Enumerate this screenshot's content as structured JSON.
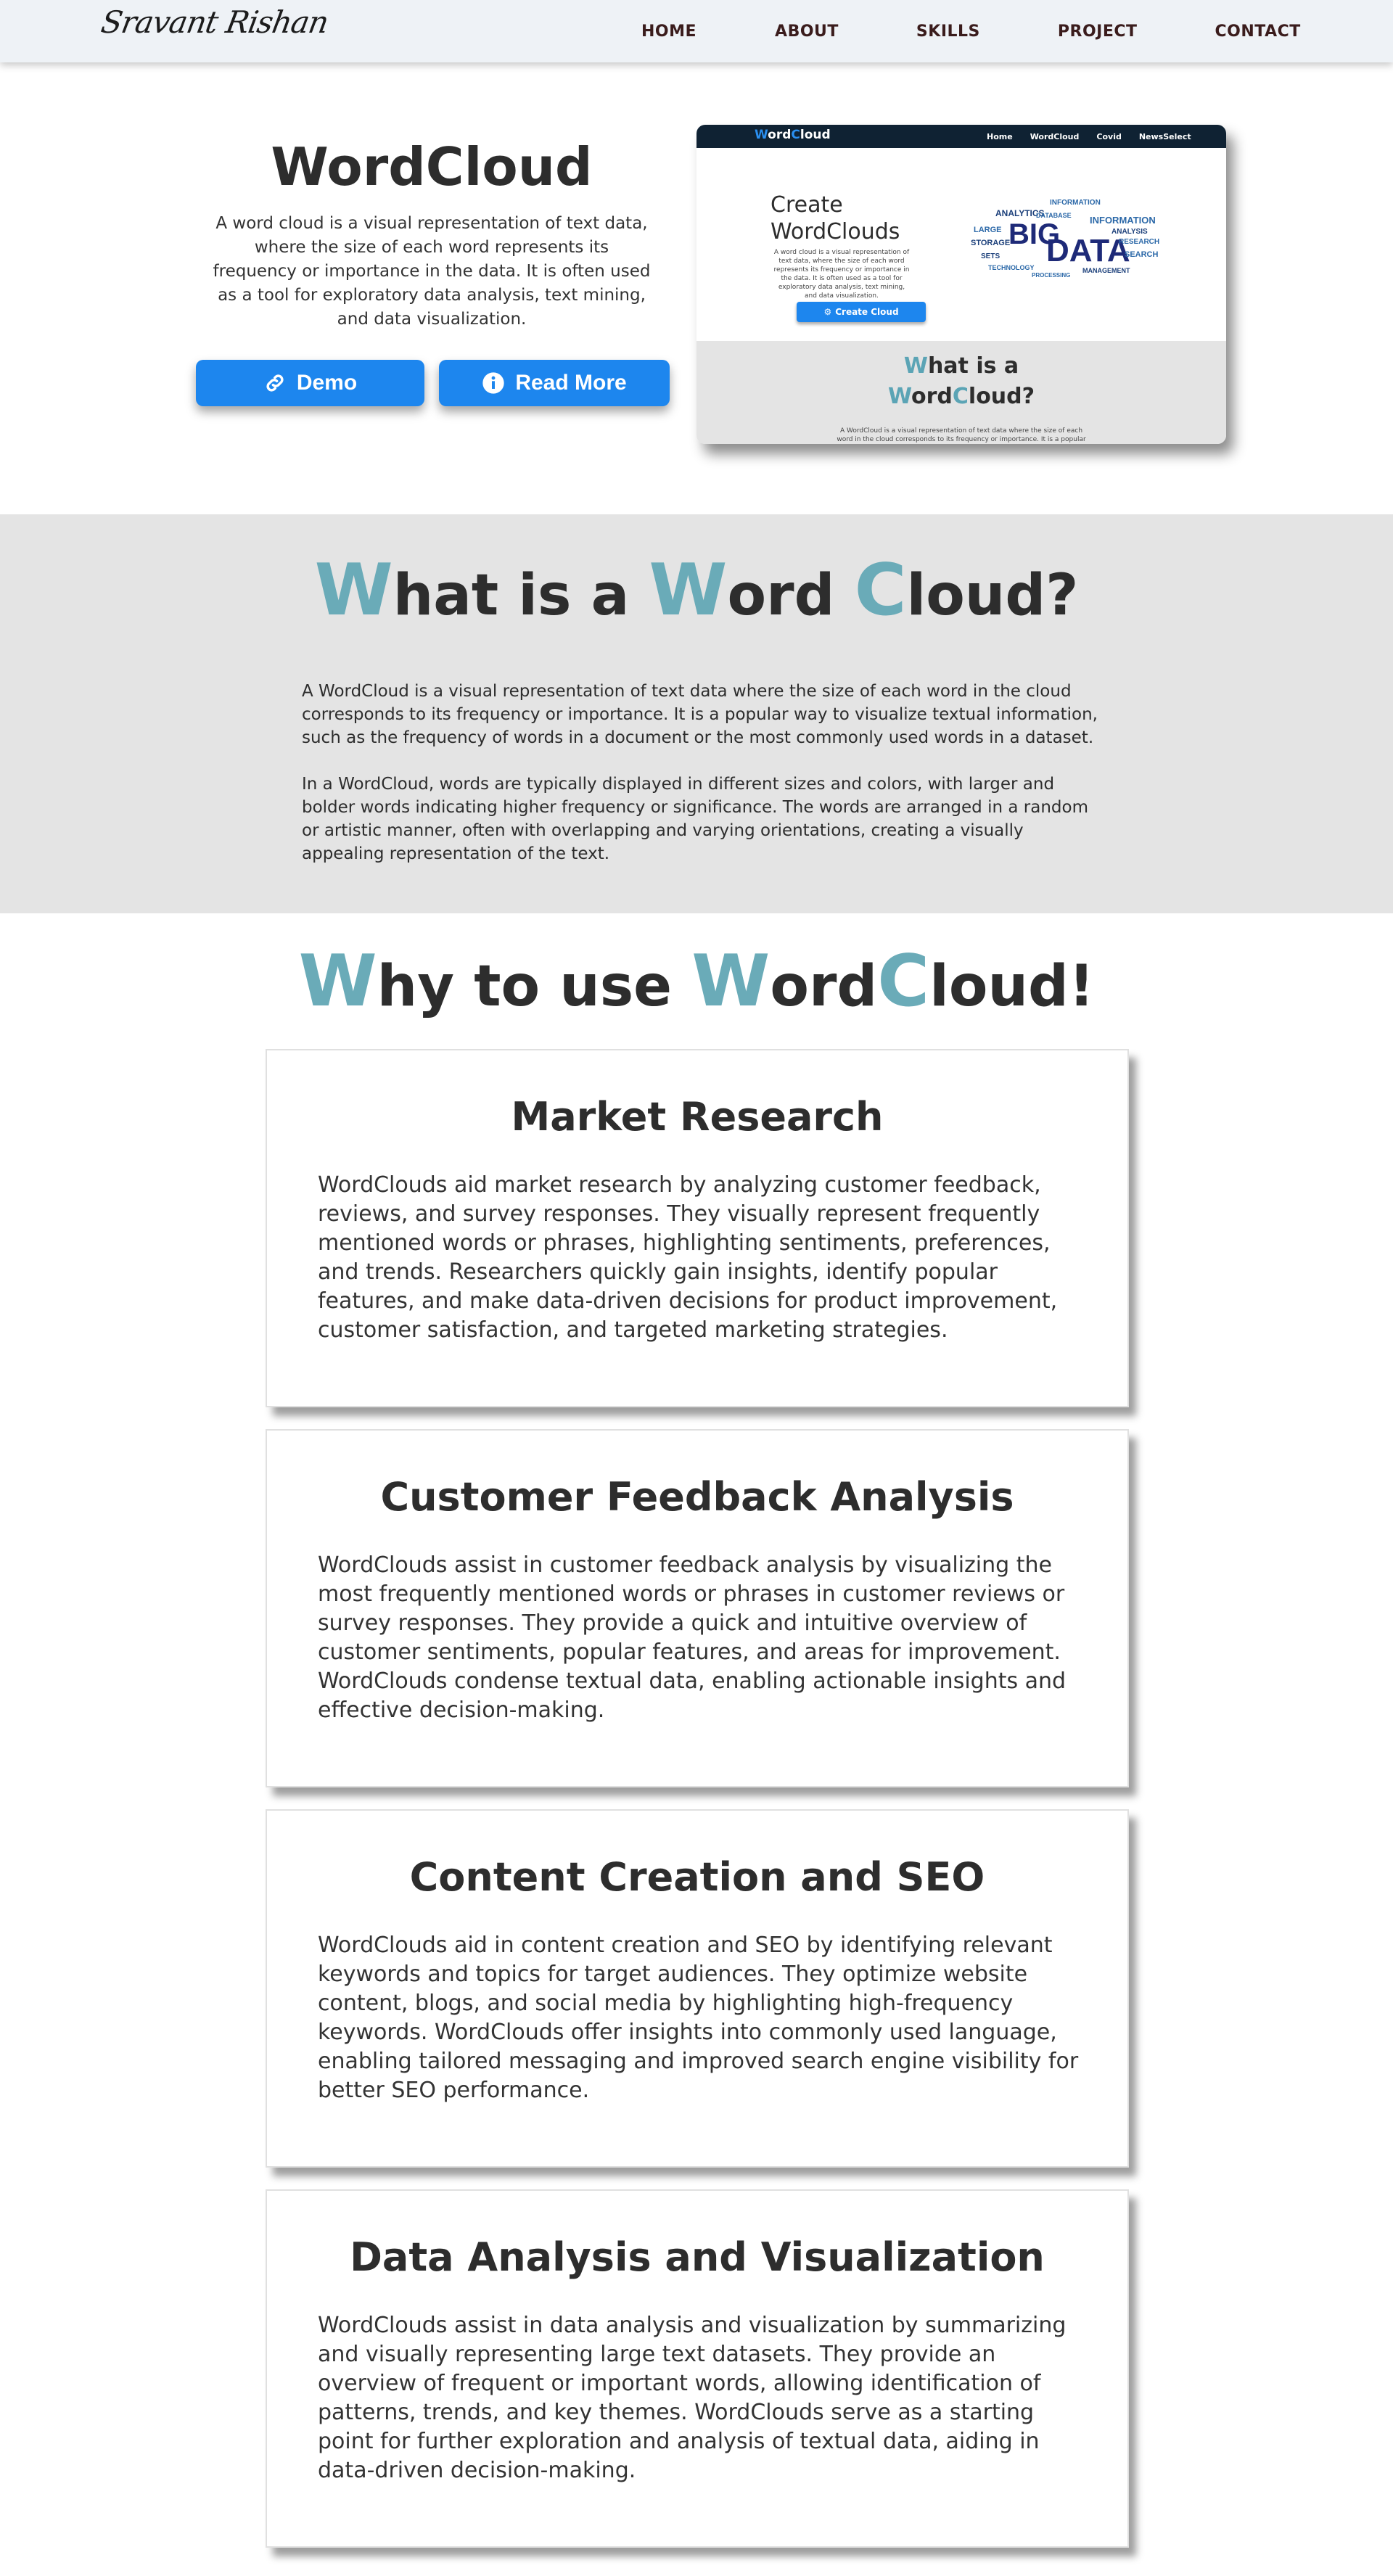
{
  "nav": {
    "logo": "Sravant Rishan",
    "links": [
      "HOME",
      "ABOUT",
      "SKILLS",
      "PROJECT",
      "CONTACT"
    ]
  },
  "hero": {
    "title": "WordCloud",
    "description": "A word cloud is a visual representation of text data, where the size of each word represents its frequency or importance in the data. It is often used as a tool for exploratory data analysis, text mining, and data visualization.",
    "demo_label": "Demo",
    "read_more_label": "Read More"
  },
  "preview": {
    "logo_first": "W",
    "logo_mid": "ord",
    "logo_c": "C",
    "logo_rest": "loud",
    "links": [
      "Home",
      "WordCloud",
      "Covid",
      "NewsSelect"
    ],
    "create_title": "Create WordClouds",
    "create_desc": "A word cloud is a visual representation of text data, where the size of each word represents its frequency or importance in the data. It is often used as a tool for exploratory data analysis, text mining, and data visualization.",
    "create_button": "Create Cloud",
    "gray_title_line1_acc": "W",
    "gray_title_line1_rest": "hat is a",
    "gray_title_line2_acc1": "W",
    "gray_title_line2_mid": "ord",
    "gray_title_line2_acc2": "C",
    "gray_title_line2_rest": "loud?",
    "gray_desc": "A WordCloud is a visual representation of text data where the size of each word in the cloud corresponds to its frequency or importance. It is a popular"
  },
  "what": {
    "t1": "W",
    "t2": "hat is a ",
    "t3": "W",
    "t4": "ord ",
    "t5": "C",
    "t6": "loud?",
    "p1": "A WordCloud is a visual representation of text data where the size of each word in the cloud corresponds to its frequency or importance. It is a popular way to visualize textual information, such as the frequency of words in a document or the most commonly used words in a dataset.",
    "p2": "In a WordCloud, words are typically displayed in different sizes and colors, with larger and bolder words indicating higher frequency or significance. The words are arranged in a random or artistic manner, often with overlapping and varying orientations, creating a visually appealing representation of the text."
  },
  "why": {
    "t1": "W",
    "t2": "hy to use ",
    "t3": "W",
    "t4": "ord",
    "t5": "C",
    "t6": "loud!",
    "cards": [
      {
        "title": "Market Research",
        "text": "WordClouds aid market research by analyzing customer feedback, reviews, and survey responses. They visually represent frequently mentioned words or phrases, highlighting sentiments, preferences, and trends. Researchers quickly gain insights, identify popular features, and make data-driven decisions for product improvement, customer satisfaction, and targeted marketing strategies."
      },
      {
        "title": "Customer Feedback Analysis",
        "text": "WordClouds assist in customer feedback analysis by visualizing the most frequently mentioned words or phrases in customer reviews or survey responses. They provide a quick and intuitive overview of customer sentiments, popular features, and areas for improvement. WordClouds condense textual data, enabling actionable insights and effective decision-making."
      },
      {
        "title": "Content Creation and SEO",
        "text": "WordClouds aid in content creation and SEO by identifying relevant keywords and topics for target audiences. They optimize website content, blogs, and social media by highlighting high-frequency keywords. WordClouds offer insights into commonly used language, enabling tailored messaging and improved search engine visibility for better SEO performance."
      },
      {
        "title": "Data Analysis and Visualization",
        "text": "WordClouds assist in data analysis and visualization by summarizing and visually representing large text datasets. They provide an overview of frequent or important words, allowing identification of patterns, trends, and key themes. WordClouds serve as a starting point for further exploration and analysis of textual data, aiding in data-driven decision-making."
      }
    ]
  },
  "colors": {
    "accent": "#6aabb8",
    "button": "#1d86ee",
    "nav_bg": "#eef2f6",
    "gray_bg": "#e4e4e4"
  }
}
